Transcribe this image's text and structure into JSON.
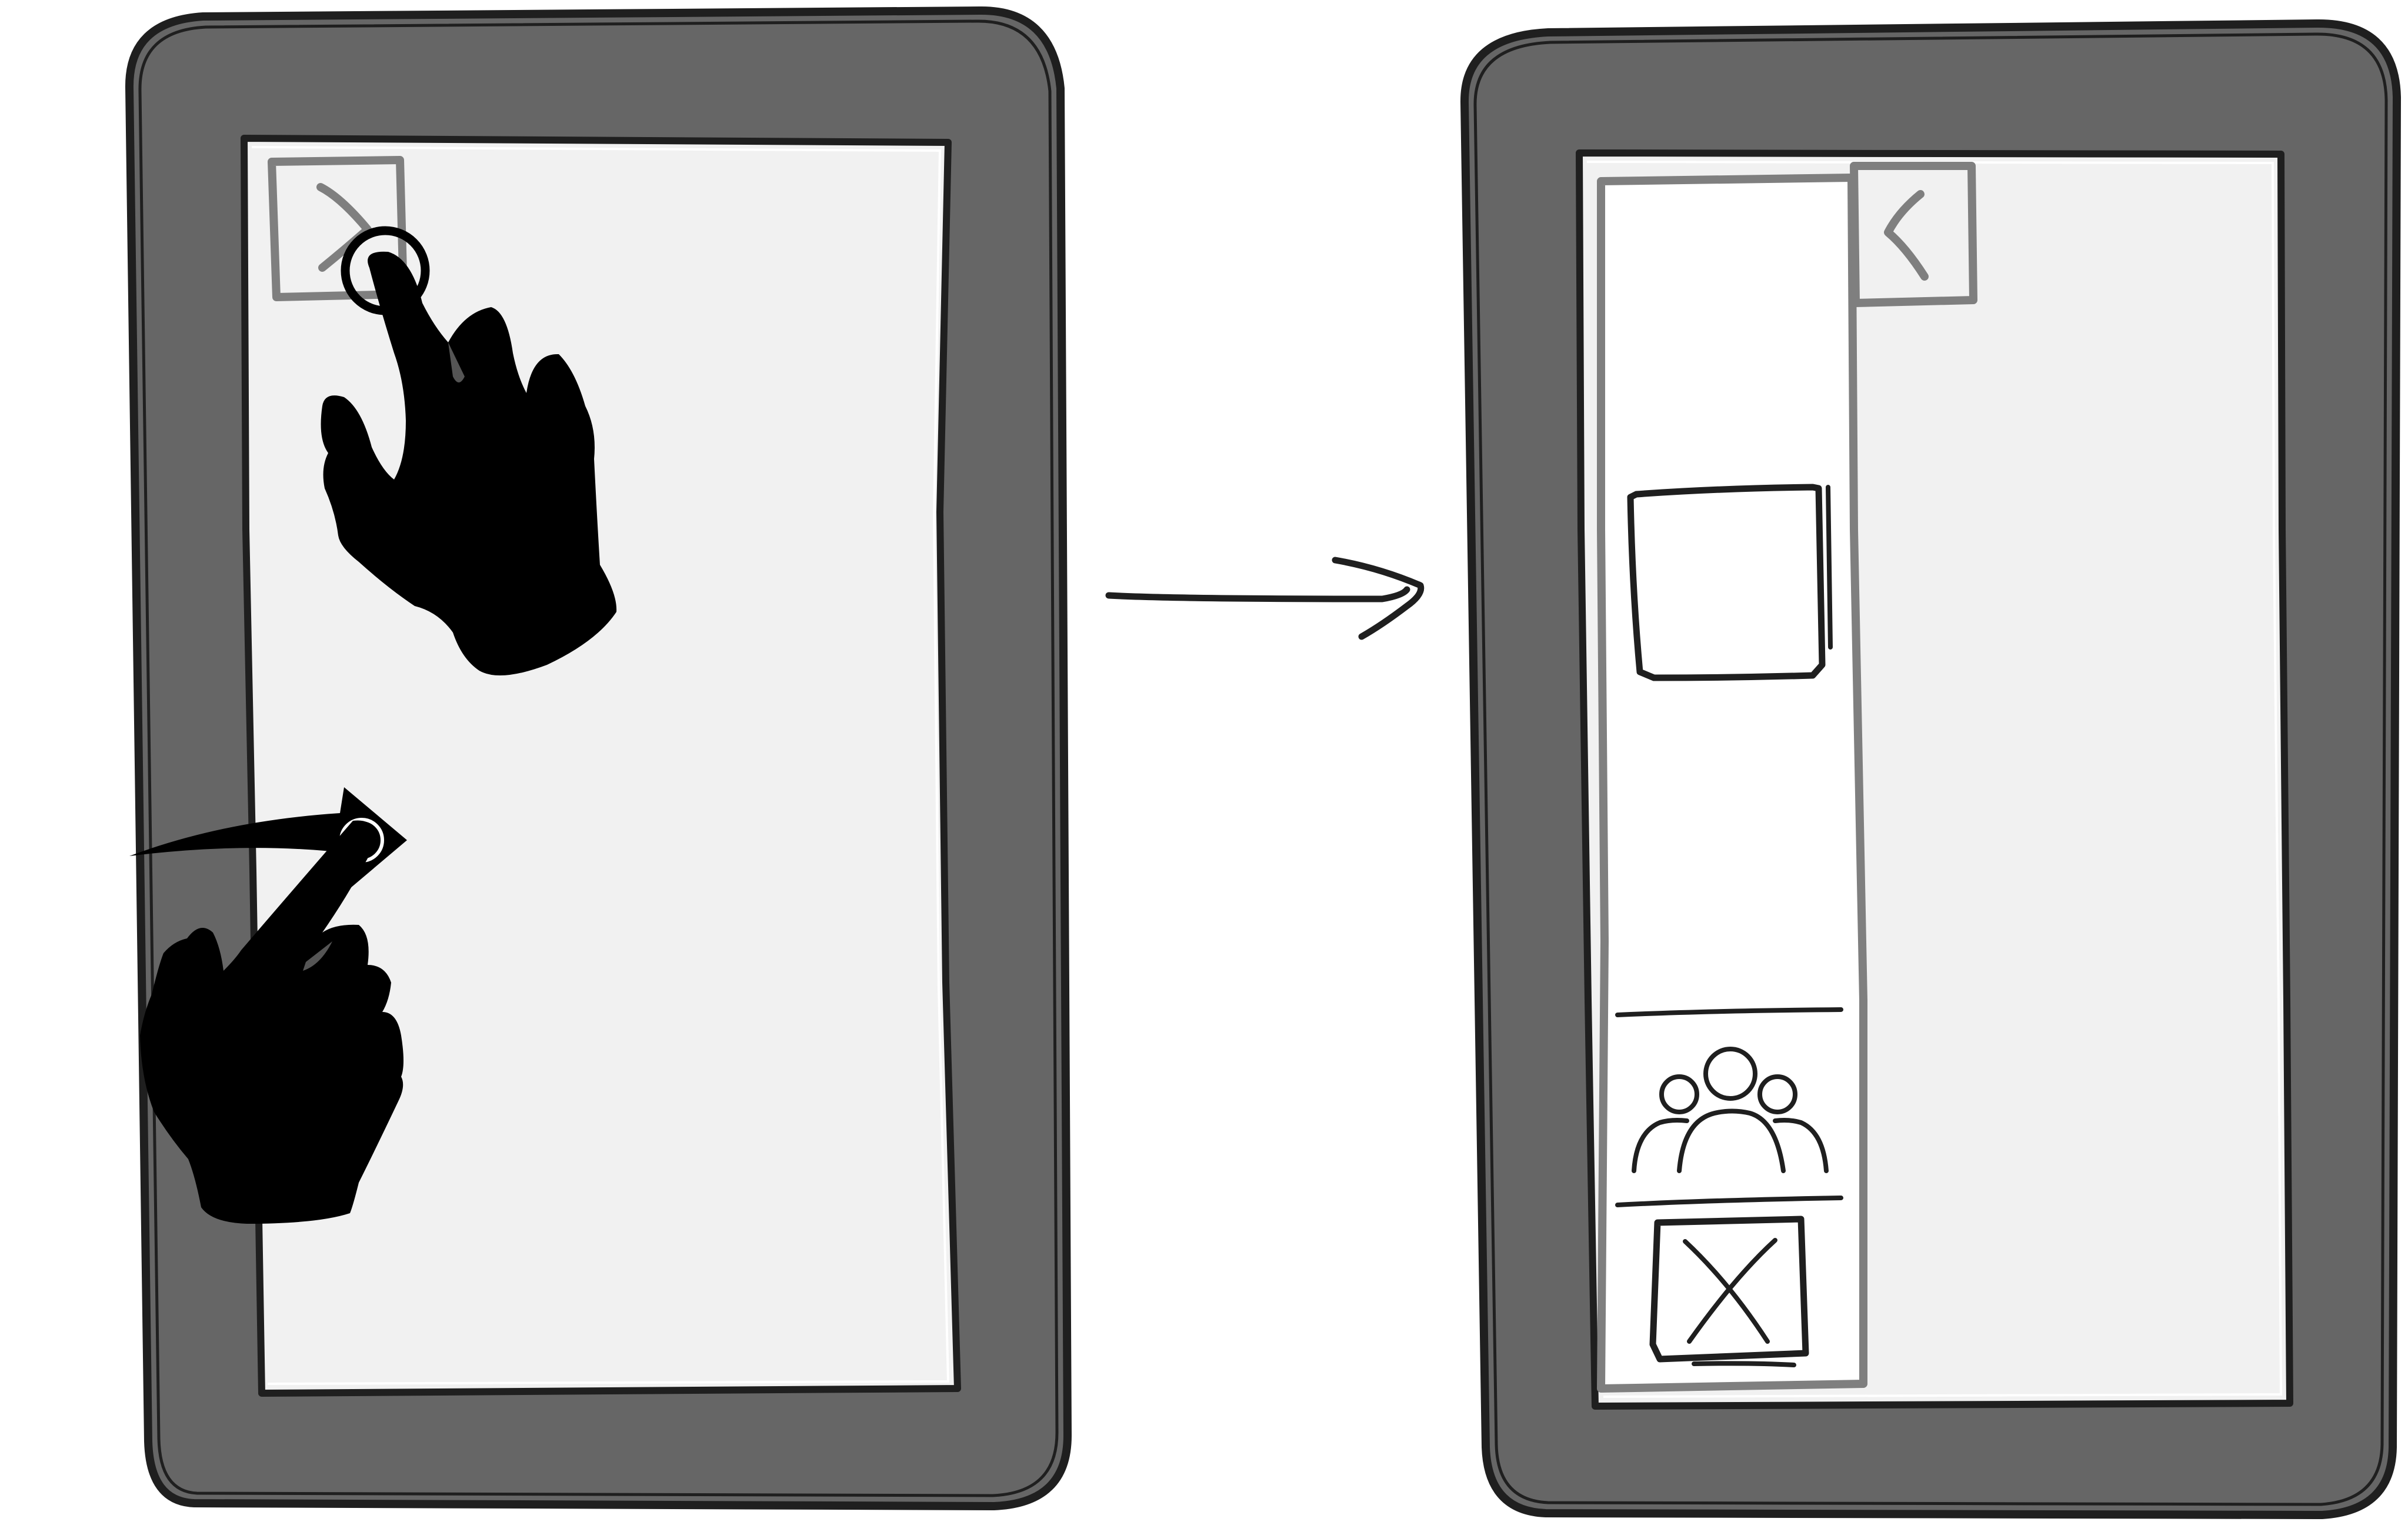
{
  "diagram": {
    "left_tablet": {
      "state": "collapsed",
      "menu_button_icon": "chevron-right-icon",
      "gesture_top": "tap",
      "gesture_bottom": "swipe-right"
    },
    "transition_arrow": "arrow-right-icon",
    "right_tablet": {
      "state": "drawer-open",
      "drawer_close_icon": "chevron-left-icon",
      "drawer_items": [
        "image-placeholder",
        "users-icon",
        "image-placeholder-crossed"
      ]
    }
  },
  "colors": {
    "bezel": "#666666",
    "screen": "#f1f1f1",
    "drawer": "#ffffff",
    "grey_ink": "#7f7f7f",
    "ink": "#1f1f1f"
  }
}
